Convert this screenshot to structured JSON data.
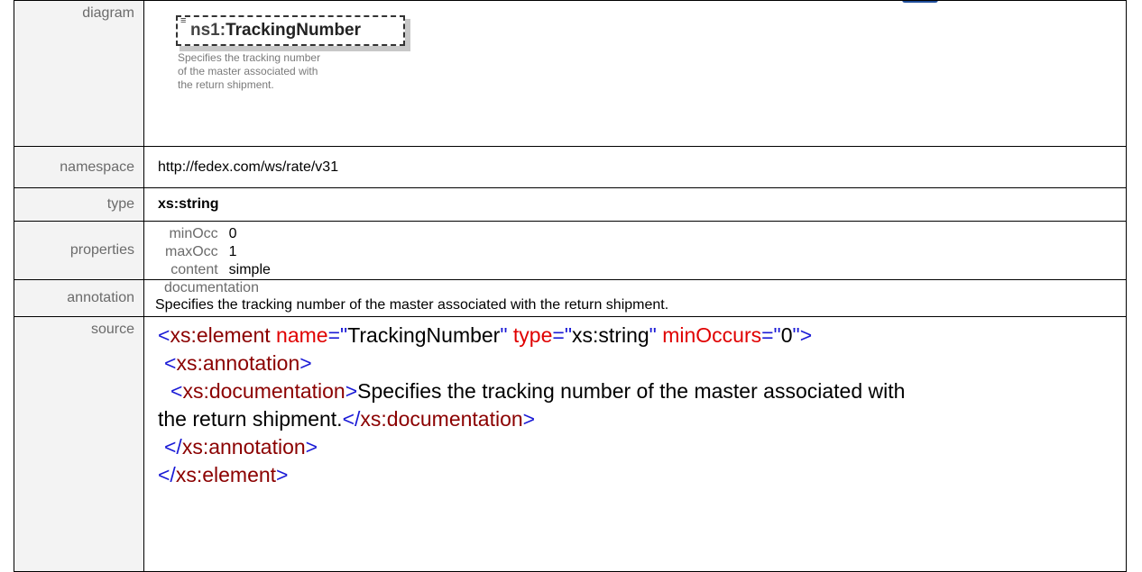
{
  "diagram": {
    "label": "diagram",
    "prefix": "ns1:",
    "name": "TrackingNumber",
    "doc_line1": "Specifies the tracking number",
    "doc_line2": "of the master associated with",
    "doc_line3": "the return shipment."
  },
  "namespace": {
    "label": "namespace",
    "value": "http://fedex.com/ws/rate/v31"
  },
  "type": {
    "label": "type",
    "value": "xs:string"
  },
  "properties": {
    "label": "properties",
    "items": [
      {
        "key": "minOcc",
        "value": "0"
      },
      {
        "key": "maxOcc",
        "value": "1"
      },
      {
        "key": "content",
        "value": "simple"
      }
    ]
  },
  "annotation": {
    "label": "annotation",
    "key": "documentation",
    "value": "Specifies the tracking number of the master associated with the return shipment."
  },
  "source": {
    "label": "source",
    "l1_open": "<",
    "l1_tag": "xs:element",
    "l1_attr1": "name",
    "l1_eq1": "=\"",
    "l1_val1": "TrackingNumber",
    "l1_q1": "\"",
    "l1_attr2": "type",
    "l1_eq2": "=\"",
    "l1_val2": "xs:string",
    "l1_q2": "\"",
    "l1_attr3": "minOccurs",
    "l1_eq3": "=\"",
    "l1_val3": "0",
    "l1_close": "\">",
    "l2_open": "<",
    "l2_tag": "xs:annotation",
    "l2_close": ">",
    "l3_open": "<",
    "l3_tag": "xs:documentation",
    "l3_close": ">",
    "l3_text": "Specifies the tracking number of the master associated with",
    "l4_text": "the return shipment.",
    "l4_open": "</",
    "l4_tag": "xs:documentation",
    "l4_close": ">",
    "l5_open": "</",
    "l5_tag": "xs:annotation",
    "l5_close": ">",
    "l6_open": "</",
    "l6_tag": "xs:element",
    "l6_close": ">"
  }
}
